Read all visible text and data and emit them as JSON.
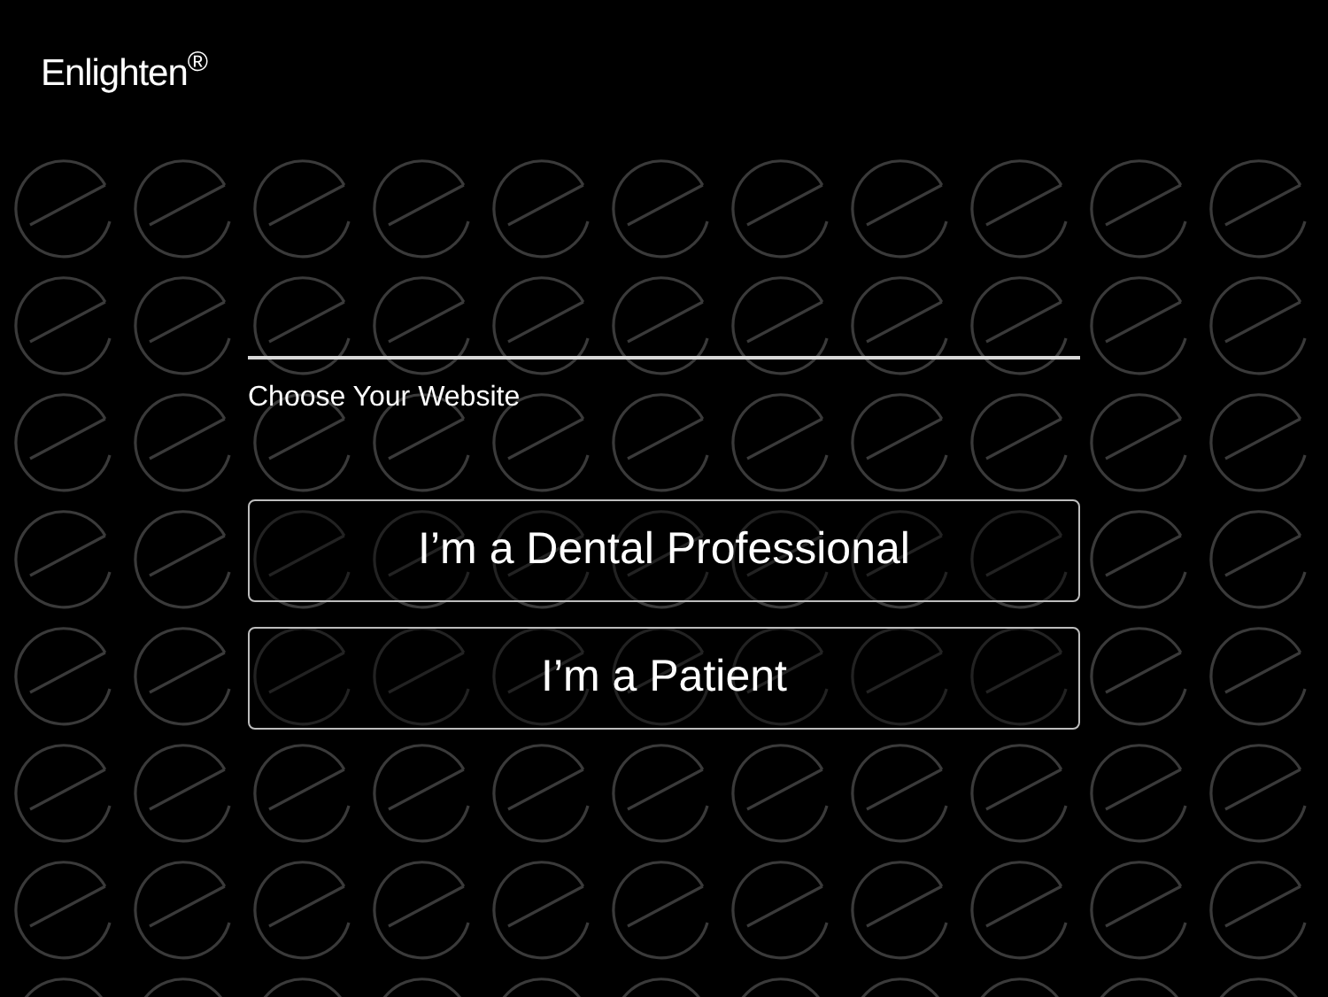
{
  "logo": "Enlighten$^{®}$",
  "heading": "Choose Your Website",
  "buttons": [
    "I’m a Dental Professional",
    "I’m a Patient"
  ]
}
